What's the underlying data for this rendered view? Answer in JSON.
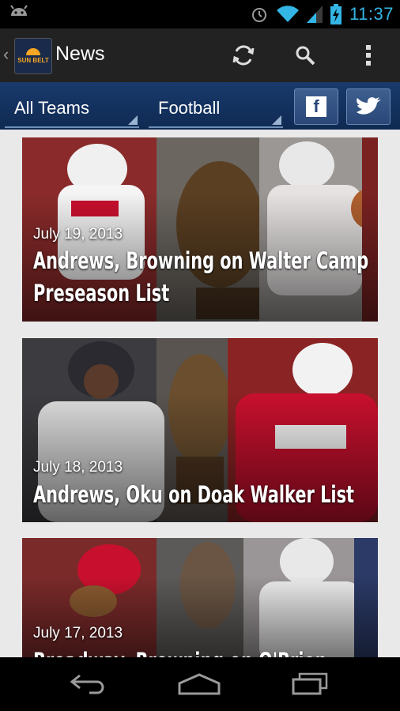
{
  "status_bar": {
    "time": "11:37",
    "icons": [
      "android-icon",
      "alarm-icon",
      "wifi-icon",
      "signal-icon",
      "battery-charging-icon"
    ]
  },
  "action_bar": {
    "title": "News",
    "logo_text": "SUN BELT",
    "actions": [
      "refresh-icon",
      "search-icon",
      "overflow-menu-icon"
    ]
  },
  "filters": {
    "team": "All Teams",
    "sport": "Football",
    "social": [
      "facebook-icon",
      "twitter-icon"
    ]
  },
  "articles": [
    {
      "date": "July 19, 2013",
      "headline_line1": "Andrews, Browning on Walter Camp",
      "headline_line2": "Preseason List"
    },
    {
      "date": "July 18, 2013",
      "headline_line1": "Andrews, Oku on Doak Walker List",
      "headline_line2": ""
    },
    {
      "date": "July 17, 2013",
      "headline_line1": "Broadway, Browning on O'Brien Preseason",
      "headline_line2": ""
    }
  ],
  "nav_bar": [
    "back-icon",
    "home-icon",
    "recent-apps-icon"
  ],
  "colors": {
    "accent": "#33b5e5",
    "filter_bar": "#193a6c",
    "wku_red": "#c8102e"
  }
}
